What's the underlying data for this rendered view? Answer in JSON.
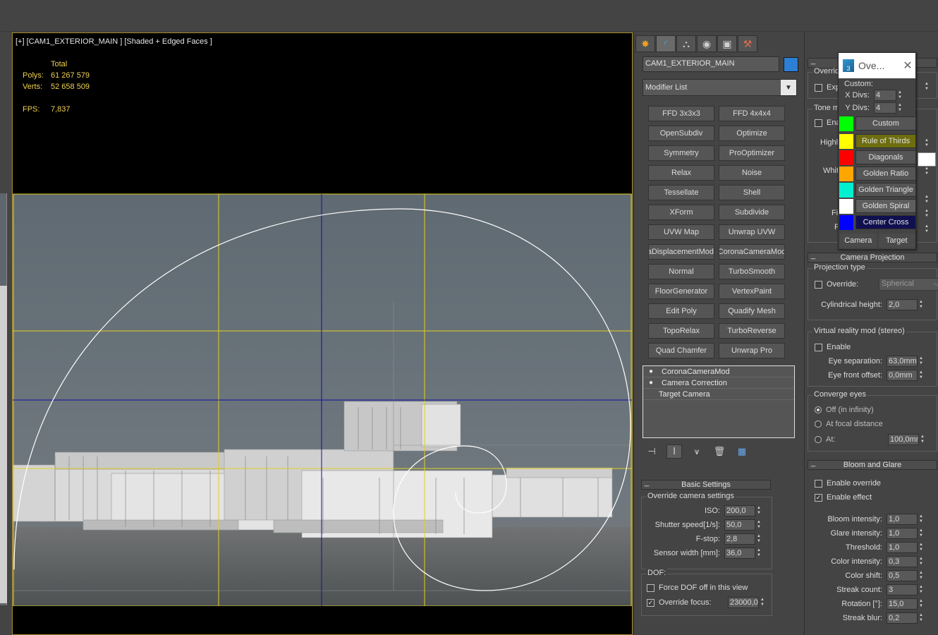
{
  "viewport": {
    "label": "[+] [CAM1_EXTERIOR_MAIN ] [Shaded + Edged Faces ]",
    "stats_header": "Total",
    "polys_label": "Polys:",
    "polys_value": "61 267 579",
    "verts_label": "Verts:",
    "verts_value": "52 658 509",
    "fps_label": "FPS:",
    "fps_value": "7,837"
  },
  "command_panel": {
    "tabs": [
      {
        "icon": "create-icon",
        "glyph": "✸"
      },
      {
        "icon": "modify-icon",
        "glyph": "◜"
      },
      {
        "icon": "hierarchy-icon",
        "glyph": "⛬"
      },
      {
        "icon": "motion-icon",
        "glyph": "◉"
      },
      {
        "icon": "display-icon",
        "glyph": "▣"
      },
      {
        "icon": "utilities-icon",
        "glyph": "⚒"
      }
    ],
    "object_name": "CAM1_EXTERIOR_MAIN",
    "object_color": "#2d7fd6",
    "modifier_list": "Modifier List",
    "modifiers": [
      "FFD 3x3x3",
      "FFD 4x4x4",
      "OpenSubdiv",
      "Optimize",
      "Symmetry",
      "ProOptimizer",
      "Relax",
      "Noise",
      "Tessellate",
      "Shell",
      "XForm",
      "Subdivide",
      "UVW Map",
      "Unwrap UVW",
      "CoronaDisplacementMod",
      "CoronaCameraMod",
      "Normal",
      "TurboSmooth",
      "FloorGenerator",
      "VertexPaint",
      "Edit Poly",
      "Quadify Mesh",
      "TopoRelax",
      "TurboReverse",
      "Quad Chamfer",
      "Unwrap Pro"
    ],
    "stack": [
      {
        "label": "CoronaCameraMod",
        "bulb": true
      },
      {
        "label": "Camera Correction",
        "bulb": true
      },
      {
        "label": "Target Camera",
        "bulb": false
      }
    ],
    "basic_settings": {
      "title": "Basic Settings",
      "override_group": "Override camera settings",
      "iso_label": "ISO:",
      "iso_value": "200,0",
      "shutter_label": "Shutter speed[1/s]:",
      "shutter_value": "50,0",
      "fstop_label": "F-stop:",
      "fstop_value": "2,8",
      "sensor_label": "Sensor width [mm]:",
      "sensor_value": "36,0",
      "dof_group": "DOF:",
      "force_dof_label": "Force DOF off in this view",
      "override_focus_label": "Override focus:",
      "override_focus_value": "23000,0"
    }
  },
  "right_panel": {
    "override_label": "Overrid",
    "exp_label": "Exp",
    "tone_label": "Tone ma",
    "enable_short": "Ena",
    "highlight_short": "Highli",
    "white_short": "Whit",
    "fi_short": "Fi",
    "f_short": "F",
    "camera_projection": {
      "title": "Camera Projection",
      "group": "Projection type",
      "override_label": "Override:",
      "override_value": "Spherical",
      "cyl_label": "Cylindrical height:",
      "cyl_value": "2,0"
    },
    "vr": {
      "group": "Virtual reality mod (stereo)",
      "enable_label": "Enable",
      "eye_sep_label": "Eye separation:",
      "eye_sep_value": "63,0mm",
      "eye_front_label": "Eye front offset:",
      "eye_front_value": "0,0mm"
    },
    "converge": {
      "group": "Converge eyes",
      "off_label": "Off (in infinity)",
      "focal_label": "At focal distance",
      "at_label": "At:",
      "at_value": "100,0mm"
    },
    "bloom": {
      "title": "Bloom and Glare",
      "enable_override_label": "Enable override",
      "enable_effect_label": "Enable effect",
      "rows": [
        {
          "label": "Bloom intensity:",
          "value": "1,0"
        },
        {
          "label": "Glare intensity:",
          "value": "1,0"
        },
        {
          "label": "Threshold:",
          "value": "1,0"
        },
        {
          "label": "Color intensity:",
          "value": "0,3"
        },
        {
          "label": "Color shift:",
          "value": "0,5"
        },
        {
          "label": "Streak count:",
          "value": "3"
        },
        {
          "label": "Rotation [°]:",
          "value": "15,0"
        },
        {
          "label": "Streak blur:",
          "value": "0,2"
        }
      ]
    }
  },
  "overlay_popup": {
    "title": "Ove...",
    "custom_label": "Custom:",
    "xdivs_label": "X Divs:",
    "xdivs_value": "4",
    "ydivs_label": "Y Divs:",
    "ydivs_value": "4",
    "items": [
      {
        "label": "Custom",
        "swatch": "#00ff00",
        "bg": "#555555"
      },
      {
        "label": "Rule of Thirds",
        "swatch": "#ffff00",
        "bg": "#6e6e10"
      },
      {
        "label": "Diagonals",
        "swatch": "#ff0000",
        "bg": "#555555"
      },
      {
        "label": "Golden Ratio",
        "swatch": "#ffa500",
        "bg": "#555555"
      },
      {
        "label": "Golden Triangle",
        "swatch": "#00f0d0",
        "bg": "#555555"
      },
      {
        "label": "Golden Spiral",
        "swatch": "#ffffff",
        "bg": "#5e5e5e"
      },
      {
        "label": "Center Cross",
        "swatch": "#0000ff",
        "bg": "#101050"
      }
    ],
    "camera_label": "Camera",
    "target_label": "Target"
  }
}
